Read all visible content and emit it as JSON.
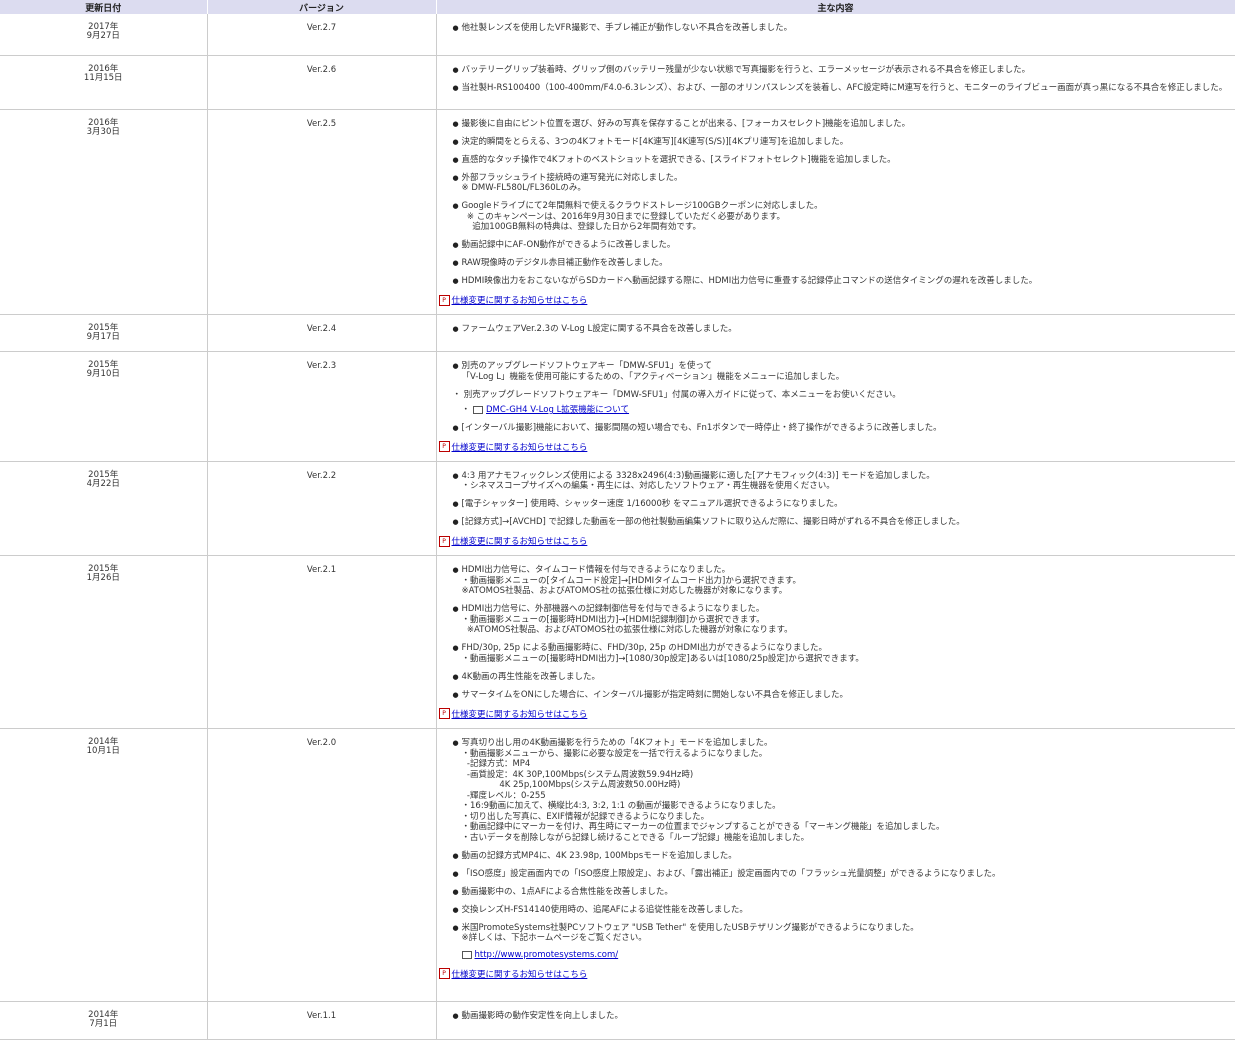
{
  "header": {
    "date": "更新日付",
    "version": "バージョン",
    "content": "主な内容"
  },
  "notice_link": "仕様変更に関するお知らせはこちら",
  "rows": [
    {
      "date_year": "2017年",
      "date_md": "9月27日",
      "version": "Ver.2.7",
      "items": [
        "他社製レンズを使用したVFR撮影で、手ブレ補正が動作しない不具合を改善しました。"
      ],
      "notice": false
    },
    {
      "date_year": "2016年",
      "date_md": "11月15日",
      "version": "Ver.2.6",
      "items": [
        "バッテリーグリップ装着時、グリップ側のバッテリー残量が少ない状態で写真撮影を行うと、エラーメッセージが表示される不具合を修正しました。",
        "当社製H-RS100400（100-400mm/F4.0-6.3レンズ）、および、一部のオリンパスレンズを装着し、AFC設定時にM連写を行うと、モニターのライブビュー画面が真っ黒になる不具合を修正しました。"
      ],
      "notice": false
    },
    {
      "date_year": "2016年",
      "date_md": "3月30日",
      "version": "Ver.2.5",
      "items": [
        "撮影後に自由にピント位置を選び、好みの写真を保存することが出来る、[フォーカスセレクト]機能を追加しました。",
        "決定的瞬間をとらえる、3つの4Kフォトモード[4K連写][4K連写(S/S)][4Kプリ連写]を追加しました。",
        "直感的なタッチ操作で4Kフォトのベストショットを選択できる、[スライドフォトセレクト]機能を追加しました。",
        "外部フラッシュライト接続時の連写発光に対応しました。\n※ DMW-FL580L/FL360Lのみ。",
        "Googleドライブにて2年間無料で使えるクラウドストレージ100GBクーポンに対応しました。\n  ※ このキャンペーンは、2016年9月30日までに登録していただく必要があります。\n    追加100GB無料の特典は、登録した日から2年間有効です。",
        "動画記録中にAF-ON動作ができるように改善しました。",
        "RAW現像時のデジタル赤目補正動作を改善しました。",
        "HDMI映像出力をおこないながらSDカードへ動画記録する際に、HDMI出力信号に重畳する記録停止コマンドの送信タイミングの遅れを改善しました。"
      ],
      "notice": true
    },
    {
      "date_year": "2015年",
      "date_md": "9月17日",
      "version": "Ver.2.4",
      "items": [
        "ファームウェアVer.2.3の V-Log L設定に関する不具合を改善しました。"
      ],
      "notice": false
    },
    {
      "date_year": "2015年",
      "date_md": "9月10日",
      "version": "Ver.2.3",
      "items": [
        "別売のアップグレードソフトウェアキー「DMW-SFU1」を使って\n「V-Log L」機能を使用可能にするための、「アクティベーション」機能をメニューに追加しました。"
      ],
      "plain": "・ 別売アップグレードソフトウェアキー「DMW-SFU1」付属の導入ガイドに従って、本メニューをお使いください。",
      "link": "DMC-GH4 V-Log L拡張機能について",
      "items2": [
        "[インターバル撮影]機能において、撮影間隔の短い場合でも、Fn1ボタンで一時停止・終了操作ができるように改善しました。"
      ],
      "notice": true
    },
    {
      "date_year": "2015年",
      "date_md": "4月22日",
      "version": "Ver.2.2",
      "items": [
        "4:3 用アナモフィックレンズ使用による 3328x2496(4:3)動画撮影に適した[アナモフィック(4:3)] モードを追加しました。\n・シネマスコープサイズへの編集・再生には、対応したソフトウェア・再生機器を使用ください。",
        "[電子シャッター] 使用時、シャッター速度 1/16000秒 をマニュアル選択できるようになりました。",
        "[記録方式]→[AVCHD] で記録した動画を一部の他社製動画編集ソフトに取り込んだ際に、撮影日時がずれる不具合を修正しました。"
      ],
      "notice": true
    },
    {
      "date_year": "2015年",
      "date_md": "1月26日",
      "version": "Ver.2.1",
      "items": [
        "HDMI出力信号に、タイムコード情報を付与できるようになりました。\n・動画撮影メニューの[タイムコード設定]→[HDMIタイムコード出力]から選択できます。\n※ATOMOS社製品、およびATOMOS社の拡張仕様に対応した機器が対象になります。",
        "HDMI出力信号に、外部機器への記録制御信号を付与できるようになりました。\n・動画撮影メニューの[撮影時HDMI出力]→[HDMI記録制御]から選択できます。\n  ※ATOMOS社製品、およびATOMOS社の拡張仕様に対応した機器が対象になります。",
        "FHD/30p, 25p による動画撮影時に、FHD/30p, 25p のHDMI出力ができるようになりました。\n・動画撮影メニューの[撮影時HDMI出力]→[1080/30p設定]あるいは[1080/25p設定]から選択できます。",
        "4K動画の再生性能を改善しました。",
        "サマータイムをONにした場合に、インターバル撮影が指定時刻に開始しない不具合を修正しました。"
      ],
      "notice": true
    },
    {
      "date_year": "2014年",
      "date_md": "10月1日",
      "version": "Ver.2.0",
      "items": [
        "写真切り出し用の4K動画撮影を行うための「4Kフォト」モードを追加しました。\n・動画撮影メニューから、撮影に必要な設定を一括で行えるようになりました。\n  -記録方式：MP4\n  -画質設定：4K 30P,100Mbps(システム周波数59.94Hz時)\n              4K 25p,100Mbps(システム周波数50.00Hz時)\n  -輝度レベル：0-255\n・16:9動画に加えて、横縦比4:3, 3:2, 1:1 の動画が撮影できるようになりました。\n・切り出した写真に、EXIF情報が記録できるようになりました。\n・動画記録中にマーカーを付け、再生時にマーカーの位置までジャンプすることができる「マーキング機能」を追加しました。\n・古いデータを削除しながら記録し続けることできる「ループ記録」機能を追加しました。",
        "動画の記録方式MP4に、4K 23.98p, 100Mbpsモードを追加しました。",
        "「ISO感度」設定画面内での「ISO感度上限設定」、および、「露出補正」設定画面内での「フラッシュ光量調整」ができるようになりました。",
        "動画撮影中の、1点AFによる合焦性能を改善しました。",
        "交換レンズH-FS14140使用時の、追尾AFによる追従性能を改善しました。",
        "米国PromoteSystems社製PCソフトウェア \"USB Tether\" を使用したUSBテザリング撮影ができるようになりました。\n※詳しくは、下記ホームページをご覧ください。"
      ],
      "link": "http://www.promotesystems.com/",
      "notice": true
    },
    {
      "date_year": "2014年",
      "date_md": "7月1日",
      "version": "Ver.1.1",
      "items": [
        "動画撮影時の動作安定性を向上しました。"
      ],
      "notice": false
    }
  ]
}
